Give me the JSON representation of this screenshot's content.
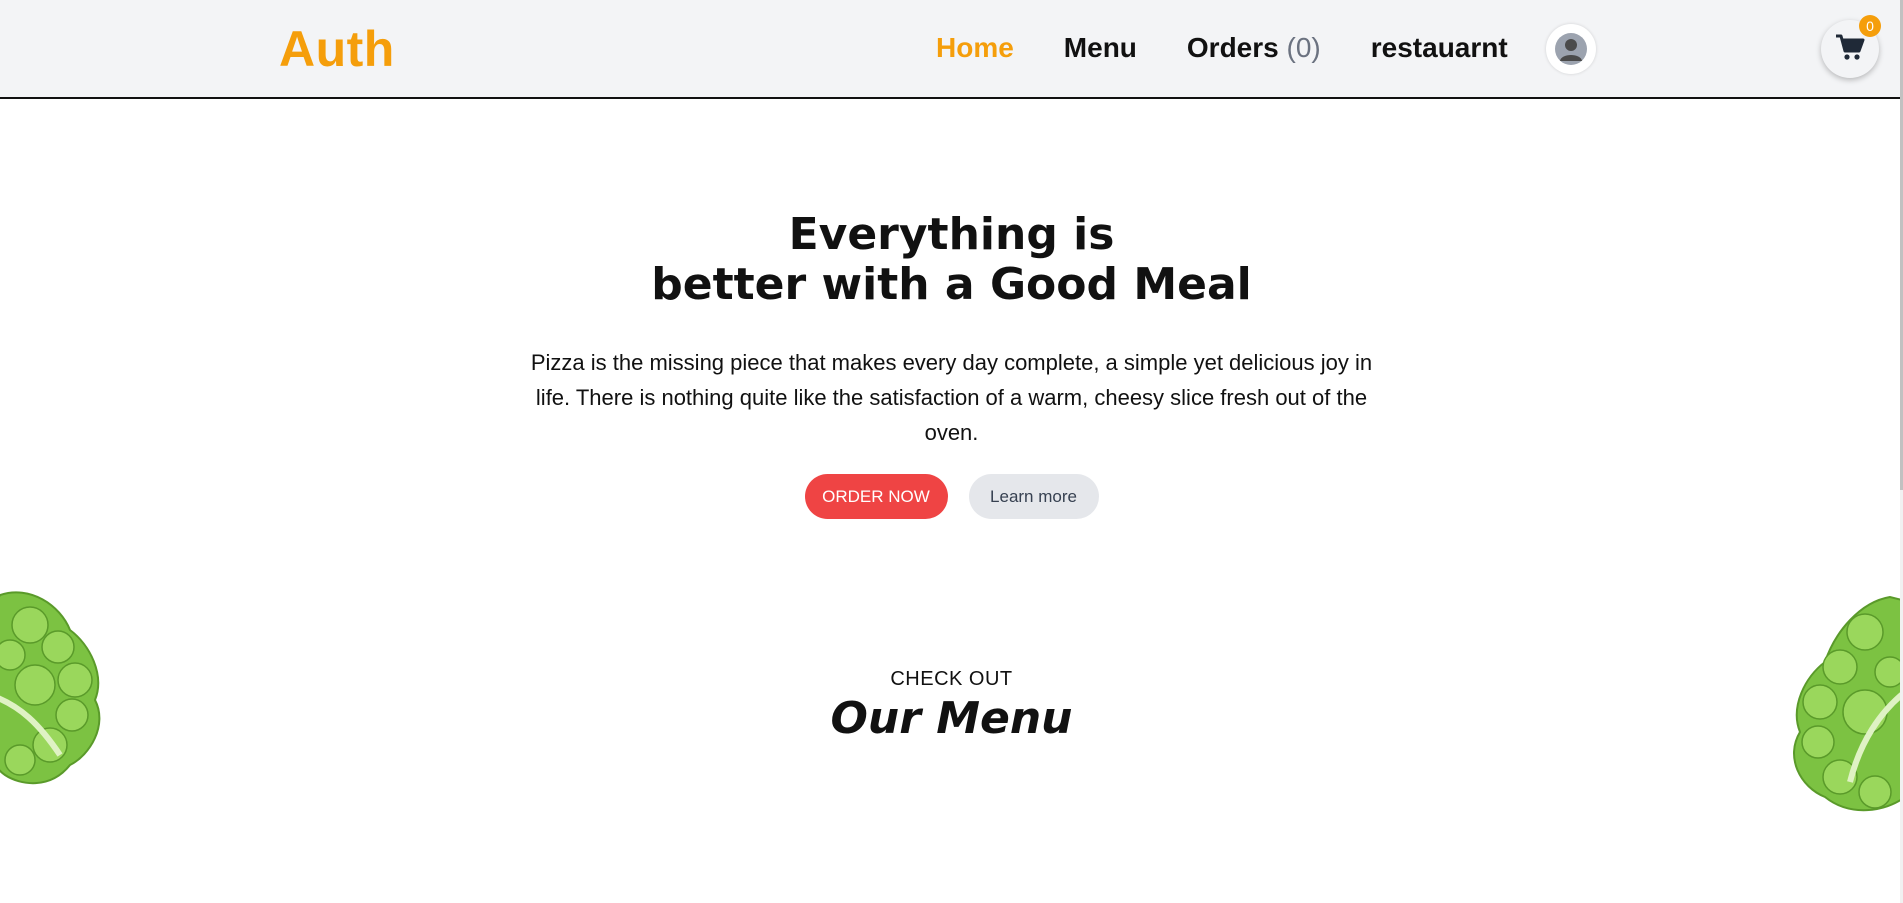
{
  "header": {
    "logo": "Auth",
    "nav": [
      {
        "label": "Home",
        "active": true
      },
      {
        "label": "Menu",
        "active": false
      },
      {
        "label": "Orders",
        "count": "(0)",
        "active": false
      },
      {
        "label": "restauarnt",
        "active": false
      }
    ],
    "cart_count": "0",
    "icons": {
      "avatar": "user-avatar-icon",
      "cart": "shopping-cart-icon"
    }
  },
  "hero": {
    "title_line1": "Everything is",
    "title_line2": "better with a Good Meal",
    "text": "Pizza is the missing piece that makes every day complete, a simple yet delicious joy in life. There is nothing quite like the satisfaction of a warm, cheesy slice fresh out of the oven.",
    "order_button": "ORDER NOW",
    "learn_button": "Learn more"
  },
  "menu_section": {
    "kicker": "CHECK OUT",
    "title": "Our Menu"
  },
  "colors": {
    "brand": "#f59e0b",
    "order_button": "#ef4444",
    "header_bg": "#f3f4f6",
    "lettuce": "#7cc242"
  }
}
